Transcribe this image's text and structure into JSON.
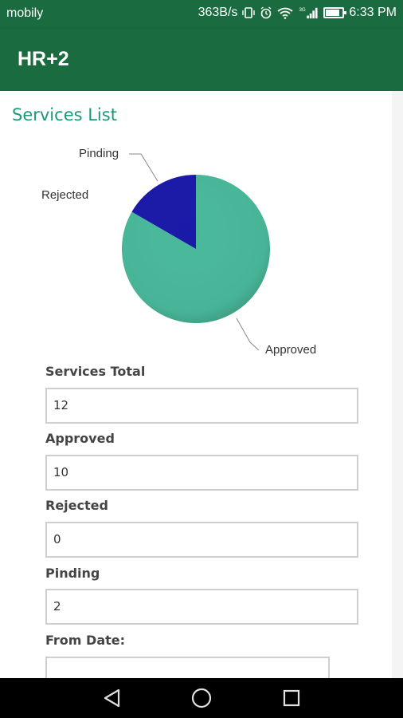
{
  "status_bar": {
    "carrier": "mobily",
    "net_speed": "363B/s",
    "network_type": "3G",
    "time": "6:33 PM",
    "icons": [
      "vibrate-icon",
      "alarm-icon",
      "wifi-icon",
      "signal-icon",
      "battery-icon"
    ],
    "battery_level": 0.75
  },
  "app_bar": {
    "title": "HR+2"
  },
  "page": {
    "title": "Services List"
  },
  "chart_data": {
    "type": "pie",
    "labels": [
      "Approved",
      "Rejected",
      "Pinding"
    ],
    "values": [
      10,
      0,
      2
    ],
    "colors": [
      "#49b89a",
      "#c62828",
      "#1a1aa8"
    ]
  },
  "fields": [
    {
      "label": "Services Total",
      "value": "12"
    },
    {
      "label": "Approved",
      "value": "10"
    },
    {
      "label": "Rejected",
      "value": "0"
    },
    {
      "label": "Pinding",
      "value": "2"
    },
    {
      "label": "From Date:",
      "value": ""
    }
  ],
  "nav": {
    "icons": [
      "back-icon",
      "home-icon",
      "recents-icon"
    ]
  },
  "colors": {
    "primary": "#1a6b3f",
    "accent": "#1a9a74"
  }
}
